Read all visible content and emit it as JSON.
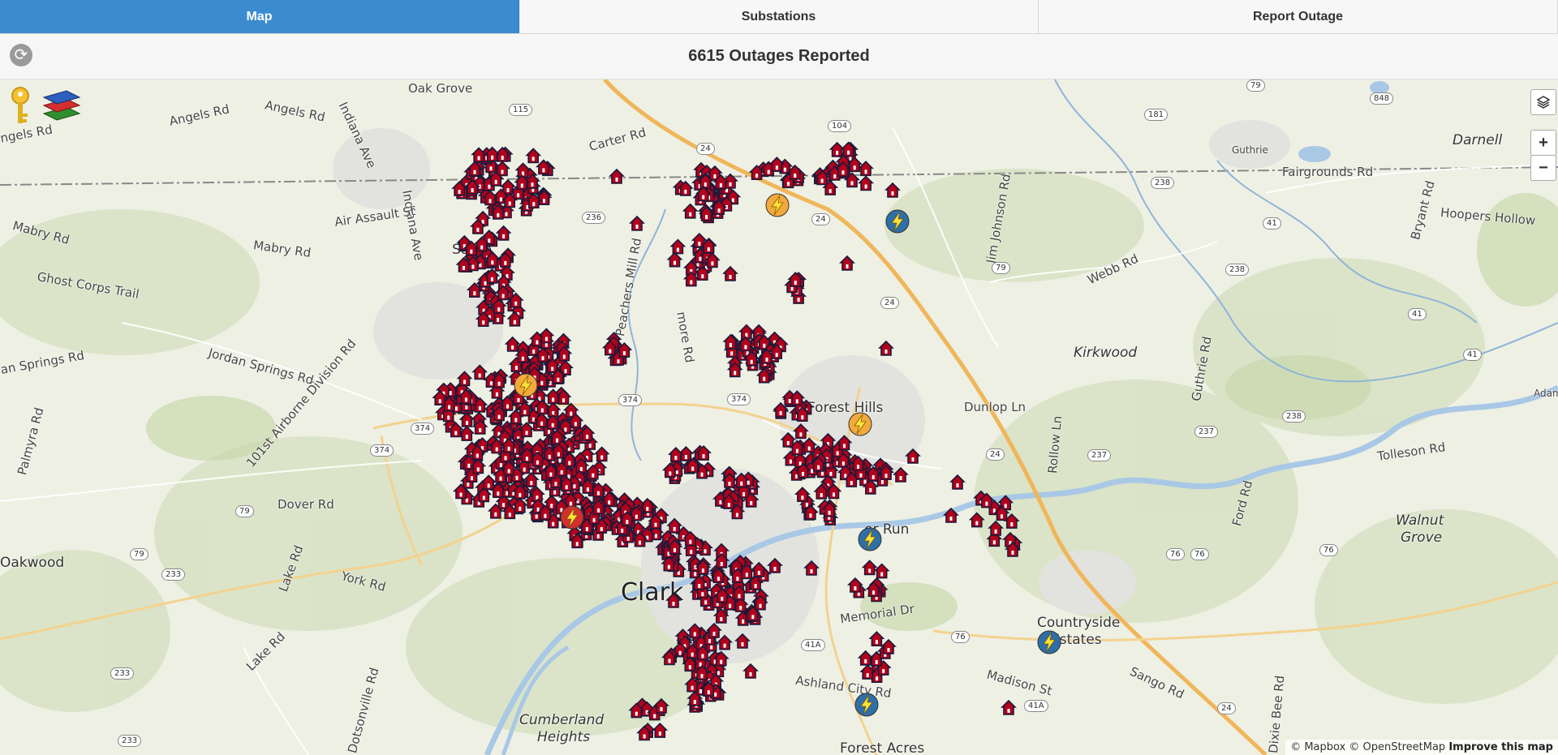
{
  "tabs": [
    {
      "label": "Map",
      "active": true
    },
    {
      "label": "Substations",
      "active": false
    },
    {
      "label": "Report Outage",
      "active": false
    }
  ],
  "header": {
    "title": "6615 Outages Reported"
  },
  "map": {
    "zoom_in_label": "+",
    "zoom_out_label": "−",
    "attribution": {
      "text": "© Mapbox © OpenStreetMap",
      "link": "Improve this map"
    },
    "labels": {
      "oak_grove": "Oak Grove",
      "angels_rd_1": "Angels Rd",
      "angels_rd_2": "Angels Rd",
      "angels_rd_3": "ngels Rd",
      "indiana_ave_1": "Indiana Ave",
      "indiana_ave_2": "Indiana Ave",
      "air_assault": "Air Assault St",
      "mabry_1": "Mabry Rd",
      "mabry_2": "Mabry Rd",
      "ghost_corps": "Ghost Corps Trail",
      "jordan_springs": "Jordan Springs Rd",
      "an_springs": "an Springs Rd",
      "airborne": "101st Airborne Division Rd",
      "palmyra": "Palmyra Rd",
      "dover": "Dover Rd",
      "oakwood": "Oakwood",
      "york": "York Rd",
      "lake_1": "Lake Rd",
      "lake_2": "Lake Rd",
      "dotsonville": "Dotsonville Rd",
      "cumberland": "Cumberland",
      "heights": "Heights",
      "clarksville": "Clark",
      "forest_hills": "Forest Hills",
      "forest_acres": "Forest Acres",
      "carter_rd": "Carter Rd",
      "peachers": "Peachers Mill Rd",
      "more_rd": "more Rd",
      "memorial": "Memorial Dr",
      "ashland": "Ashland City Rd",
      "countryside": "Countryside",
      "estates": "Estates",
      "madison": "Madison St",
      "sango": "Sango Rd",
      "dixie_bee": "Dixie Bee Rd",
      "jim_johnson": "Jim Johnson Rd",
      "dunlop": "Dunlop Ln",
      "rollow": "Rollow Ln",
      "kirkwood": "Kirkwood",
      "guthrie_rd": "Guthrie Rd",
      "guthrie": "Guthrie",
      "fairgrounds": "Fairgrounds Rd",
      "webb": "Webb Rd",
      "bryant": "Bryant Rd",
      "hoopers": "Hoopers Hollow",
      "darnell": "Darnell",
      "tolleson": "Tolleson Rd",
      "walnut": "Walnut",
      "grove": "Grove",
      "ford_rd": "Ford Rd",
      "adam": "Adam",
      "run": "er Run",
      "stone": "Stone",
      "wood": "k"
    },
    "shields": [
      "115",
      "24",
      "104",
      "236",
      "236",
      "24",
      "79",
      "79",
      "24",
      "374",
      "374",
      "374",
      "374",
      "79",
      "79",
      "24",
      "233",
      "233",
      "233",
      "41A",
      "41A",
      "76",
      "76",
      "76",
      "76",
      "41A",
      "24",
      "237",
      "237",
      "238",
      "238",
      "238",
      "41",
      "41",
      "41",
      "181",
      "848",
      "79",
      "24"
    ],
    "substation_colors": {
      "orange": "#f4a93b",
      "red": "#d32f2f",
      "blue": "#2e6fa8"
    },
    "outage_icon": "house-outage-icon"
  }
}
